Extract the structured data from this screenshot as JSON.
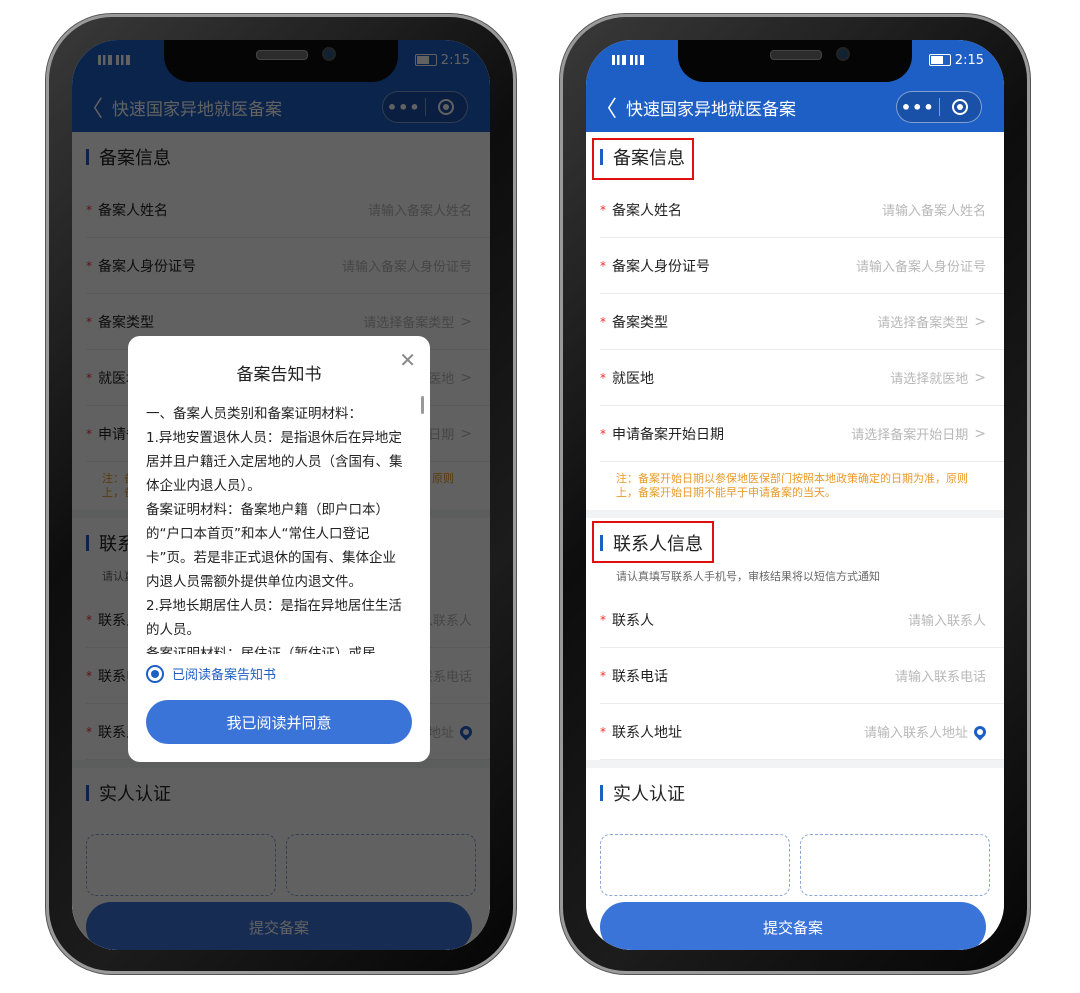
{
  "status": {
    "left": "HD 4G 2G",
    "time": "2:15"
  },
  "app": {
    "back_glyph": "〈",
    "title": "快速国家异地就医备案",
    "more_glyph": "•••"
  },
  "sections": {
    "filing_info": "备案信息",
    "contact_info": "联系人信息",
    "real_person": "实人认证"
  },
  "fields": {
    "name": {
      "label": "备案人姓名",
      "placeholder": "请输入备案人姓名"
    },
    "id_number": {
      "label": "备案人身份证号",
      "placeholder": "请输入备案人身份证号"
    },
    "type": {
      "label": "备案类型",
      "placeholder": "请选择备案类型"
    },
    "place": {
      "label": "就医地",
      "placeholder": "请选择就医地"
    },
    "start_date": {
      "label": "申请备案开始日期",
      "placeholder": "请选择备案开始日期"
    },
    "contact": {
      "label": "联系人",
      "placeholder": "请输入联系人"
    },
    "contact_phone": {
      "label": "联系电话",
      "placeholder": "请输入联系电话"
    },
    "contact_address": {
      "label": "联系人地址",
      "placeholder": "请输入联系人地址"
    }
  },
  "note": "注：备案开始日期以参保地医保部门按照本地政策确定的日期为准，原则上，备案开始日期不能早于申请备案的当天。",
  "contact_sub": "请认真填写联系人手机号，审核结果将以短信方式通知",
  "submit_label": "提交备案",
  "modal": {
    "title": "备案告知书",
    "close_glyph": "✕",
    "paragraphs": [
      "一、备案人员类别和备案证明材料：",
      "1.异地安置退休人员：是指退休后在异地定居并且户籍迁入定居地的人员（含国有、集体企业内退人员）。",
      "备案证明材料：备案地户籍（即户口本）的“户口本首页”和本人“常住人口登记卡”页。若是非正式退休的国有、集体企业内退人员需额外提供单位内退文件。",
      "2.异地长期居住人员：是指在异地居住生活的人员。",
      "备案证明材料：居住证（暂住证）或居"
    ],
    "checkbox_label": "已阅读备案告知书",
    "agree_label": "我已阅读并同意"
  },
  "colors": {
    "brand": "#1e5fc6",
    "button": "#3b74d8",
    "required": "#ee3333",
    "note": "#e99a2a",
    "highlight": "#e01010"
  }
}
